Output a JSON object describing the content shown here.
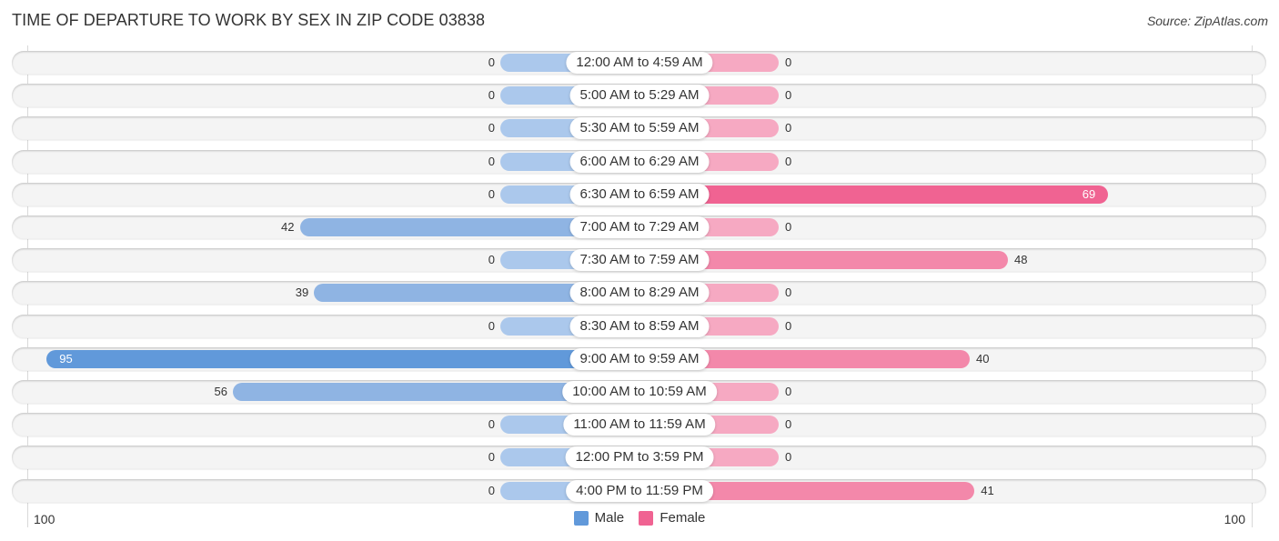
{
  "header": {
    "title": "TIME OF DEPARTURE TO WORK BY SEX IN ZIP CODE 03838",
    "source": "Source: ZipAtlas.com"
  },
  "chart_data": {
    "type": "bar",
    "orientation": "horizontal-diverging",
    "title": "TIME OF DEPARTURE TO WORK BY SEX IN ZIP CODE 03838",
    "xlabel": "",
    "ylabel": "",
    "xlim": [
      0,
      100
    ],
    "tick_labels": {
      "left": "100",
      "right": "100"
    },
    "legend_position": "bottom-center",
    "categories": [
      "12:00 AM to 4:59 AM",
      "5:00 AM to 5:29 AM",
      "5:30 AM to 5:59 AM",
      "6:00 AM to 6:29 AM",
      "6:30 AM to 6:59 AM",
      "7:00 AM to 7:29 AM",
      "7:30 AM to 7:59 AM",
      "8:00 AM to 8:29 AM",
      "8:30 AM to 8:59 AM",
      "9:00 AM to 9:59 AM",
      "10:00 AM to 10:59 AM",
      "11:00 AM to 11:59 AM",
      "12:00 PM to 3:59 PM",
      "4:00 PM to 11:59 PM"
    ],
    "series": [
      {
        "name": "Male",
        "color": "#6199da",
        "side": "left",
        "values": [
          0,
          0,
          0,
          0,
          0,
          42,
          0,
          39,
          0,
          95,
          56,
          0,
          0,
          0
        ]
      },
      {
        "name": "Female",
        "color": "#f06392",
        "side": "right",
        "values": [
          0,
          0,
          0,
          0,
          69,
          0,
          48,
          0,
          0,
          40,
          0,
          0,
          0,
          41
        ]
      }
    ]
  },
  "legend": {
    "male_label": "Male",
    "female_label": "Female",
    "male_color": "#6199da",
    "female_color": "#f06392"
  }
}
